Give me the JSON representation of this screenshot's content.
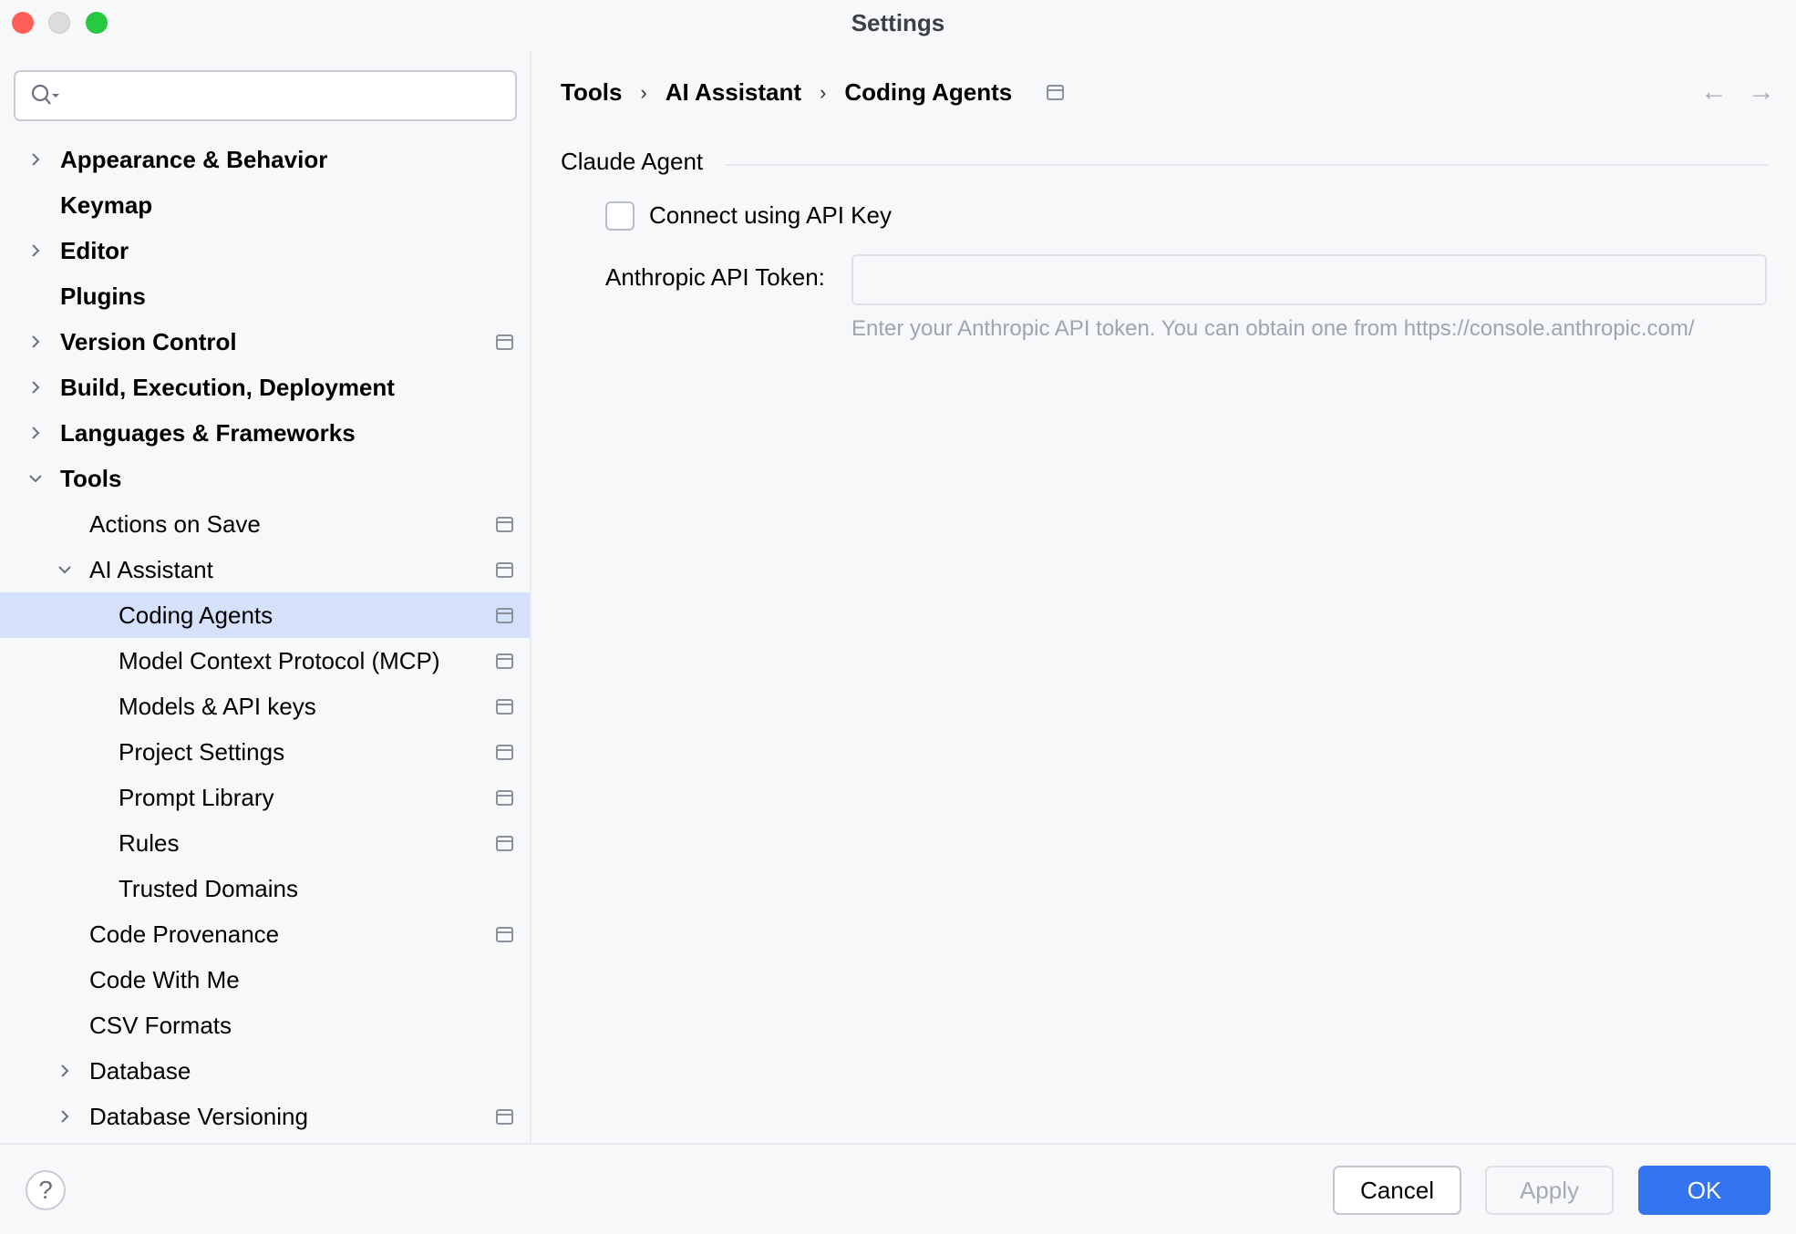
{
  "window": {
    "title": "Settings"
  },
  "search": {
    "placeholder": ""
  },
  "tree": [
    {
      "label": "Appearance & Behavior",
      "level": 0,
      "bold": true,
      "chevron": "right",
      "pin": false
    },
    {
      "label": "Keymap",
      "level": 0,
      "bold": true,
      "chevron": "",
      "pin": false
    },
    {
      "label": "Editor",
      "level": 0,
      "bold": true,
      "chevron": "right",
      "pin": false
    },
    {
      "label": "Plugins",
      "level": 0,
      "bold": true,
      "chevron": "",
      "pin": false
    },
    {
      "label": "Version Control",
      "level": 0,
      "bold": true,
      "chevron": "right",
      "pin": true
    },
    {
      "label": "Build, Execution, Deployment",
      "level": 0,
      "bold": true,
      "chevron": "right",
      "pin": false
    },
    {
      "label": "Languages & Frameworks",
      "level": 0,
      "bold": true,
      "chevron": "right",
      "pin": false
    },
    {
      "label": "Tools",
      "level": 0,
      "bold": true,
      "chevron": "down",
      "pin": false
    },
    {
      "label": "Actions on Save",
      "level": 1,
      "bold": false,
      "chevron": "",
      "pin": true
    },
    {
      "label": "AI Assistant",
      "level": 1,
      "bold": false,
      "chevron": "down",
      "pin": true
    },
    {
      "label": "Coding Agents",
      "level": 2,
      "bold": false,
      "chevron": "",
      "pin": true,
      "selected": true
    },
    {
      "label": "Model Context Protocol (MCP)",
      "level": 2,
      "bold": false,
      "chevron": "",
      "pin": true
    },
    {
      "label": "Models & API keys",
      "level": 2,
      "bold": false,
      "chevron": "",
      "pin": true
    },
    {
      "label": "Project Settings",
      "level": 2,
      "bold": false,
      "chevron": "",
      "pin": true
    },
    {
      "label": "Prompt Library",
      "level": 2,
      "bold": false,
      "chevron": "",
      "pin": true
    },
    {
      "label": "Rules",
      "level": 2,
      "bold": false,
      "chevron": "",
      "pin": true
    },
    {
      "label": "Trusted Domains",
      "level": 2,
      "bold": false,
      "chevron": "",
      "pin": false
    },
    {
      "label": "Code Provenance",
      "level": 1,
      "bold": false,
      "chevron": "",
      "pin": true
    },
    {
      "label": "Code With Me",
      "level": 1,
      "bold": false,
      "chevron": "",
      "pin": false
    },
    {
      "label": "CSV Formats",
      "level": 1,
      "bold": false,
      "chevron": "",
      "pin": false
    },
    {
      "label": "Database",
      "level": 1,
      "bold": false,
      "chevron": "right",
      "pin": false
    },
    {
      "label": "Database Versioning",
      "level": 1,
      "bold": false,
      "chevron": "right",
      "pin": true
    }
  ],
  "breadcrumb": {
    "items": [
      "Tools",
      "AI Assistant",
      "Coding Agents"
    ],
    "separator": "›",
    "back": "←",
    "forward": "→"
  },
  "content": {
    "group_title": "Claude Agent",
    "checkbox_label": "Connect using API Key",
    "checkbox_checked": false,
    "token_label": "Anthropic API Token:",
    "token_value": "",
    "hint": "Enter your Anthropic API token. You can obtain one from https://console.anthropic.com/"
  },
  "footer": {
    "help": "?",
    "cancel": "Cancel",
    "apply": "Apply",
    "ok": "OK"
  },
  "colors": {
    "accent": "#3574f0",
    "selection": "#d5e1fb",
    "close": "#fe5f57",
    "minimize": "#dcdcdc",
    "maximize": "#28c840"
  }
}
